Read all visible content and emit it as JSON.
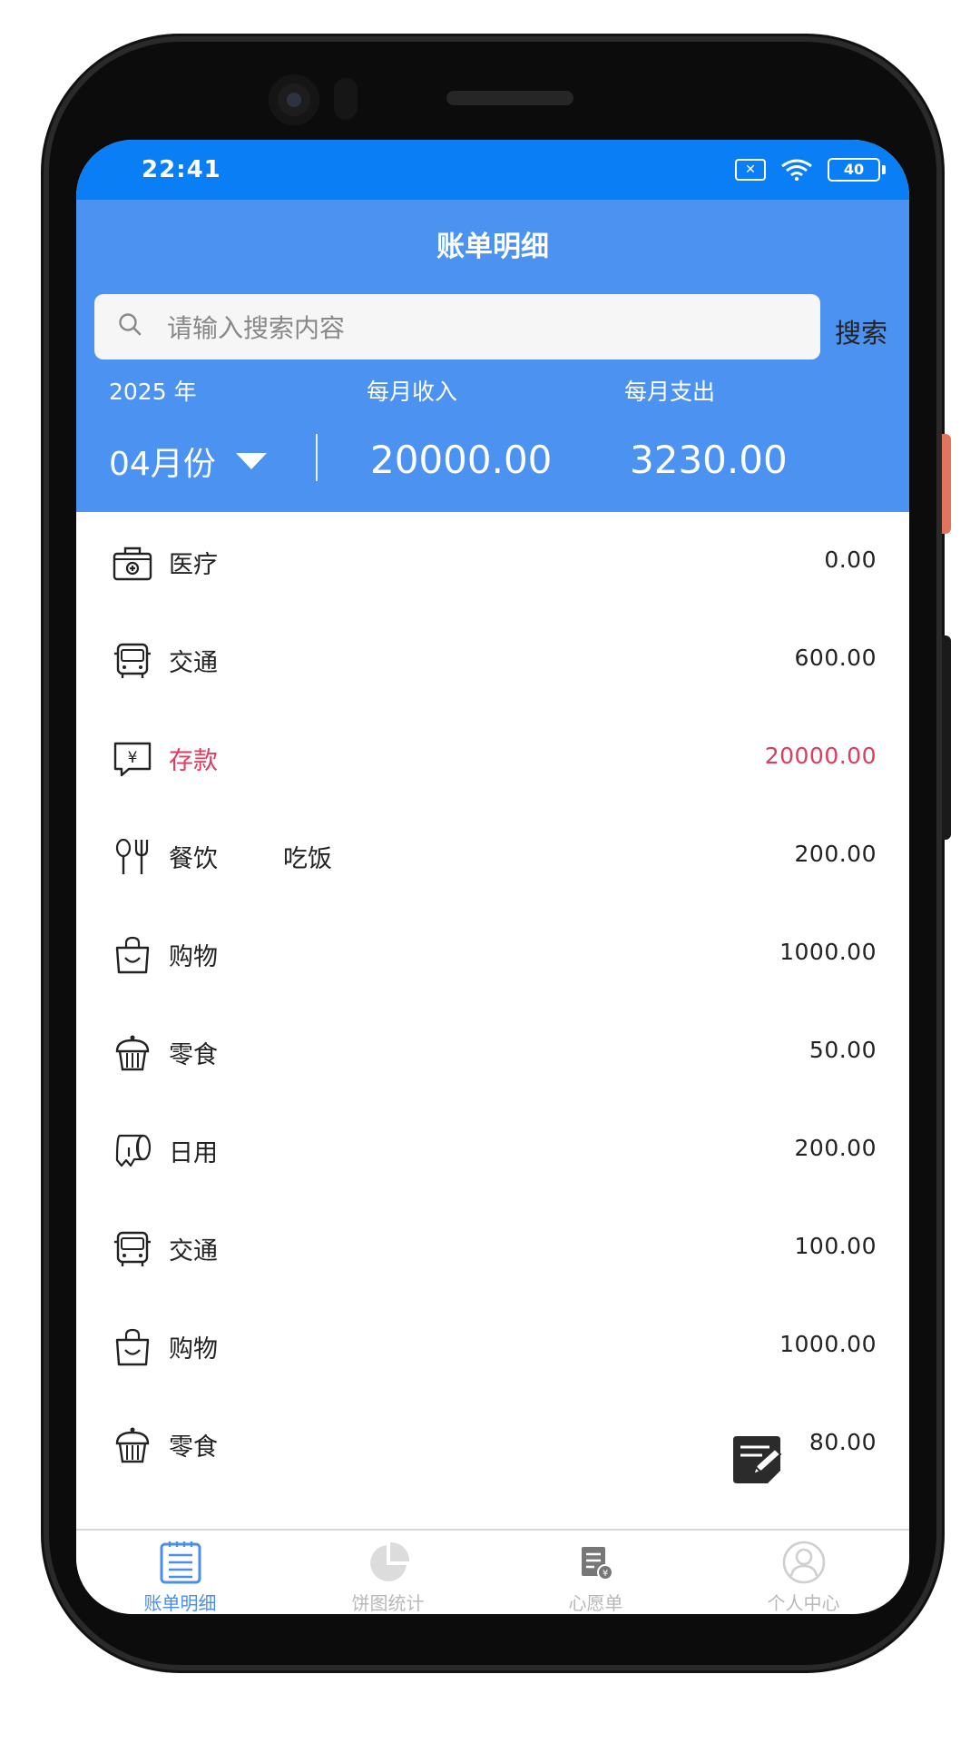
{
  "status_bar": {
    "time": "22:41",
    "battery": "40"
  },
  "header": {
    "title": "账单明细",
    "search": {
      "placeholder": "请输入搜索内容",
      "button": "搜索"
    },
    "year_label": "2025 年",
    "income_label": "每月收入",
    "expense_label": "每月支出",
    "month": "04月份",
    "income_amount": "20000.00",
    "expense_amount": "3230.00"
  },
  "records": [
    {
      "icon": "medical-kit-icon",
      "category": "医疗",
      "note": "",
      "amount": "0.00",
      "highlight": false
    },
    {
      "icon": "bus-icon",
      "category": "交通",
      "note": "",
      "amount": "600.00",
      "highlight": false
    },
    {
      "icon": "yuan-deposit-icon",
      "category": "存款",
      "note": "",
      "amount": "20000.00",
      "highlight": true
    },
    {
      "icon": "fork-spoon-icon",
      "category": "餐饮",
      "note": "吃饭",
      "amount": "200.00",
      "highlight": false
    },
    {
      "icon": "shopping-bag-icon",
      "category": "购物",
      "note": "",
      "amount": "1000.00",
      "highlight": false
    },
    {
      "icon": "cupcake-icon",
      "category": "零食",
      "note": "",
      "amount": "50.00",
      "highlight": false
    },
    {
      "icon": "tissue-roll-icon",
      "category": "日用",
      "note": "",
      "amount": "200.00",
      "highlight": false
    },
    {
      "icon": "bus-icon",
      "category": "交通",
      "note": "",
      "amount": "100.00",
      "highlight": false
    },
    {
      "icon": "shopping-bag-icon",
      "category": "购物",
      "note": "",
      "amount": "1000.00",
      "highlight": false
    },
    {
      "icon": "cupcake-icon",
      "category": "零食",
      "note": "",
      "amount": "80.00",
      "highlight": false
    }
  ],
  "colors": {
    "primary": "#4c92f0",
    "status_bar": "#0a7ff5",
    "highlight": "#e23a5e",
    "tab_active": "#4a8ee8",
    "tab_inactive": "#b8b8b8"
  },
  "tabs": [
    {
      "label": "账单明细",
      "icon": "bill-list-icon",
      "active": true
    },
    {
      "label": "饼图统计",
      "icon": "pie-chart-icon",
      "active": false
    },
    {
      "label": "心愿单",
      "icon": "wish-list-icon",
      "active": false
    },
    {
      "label": "个人中心",
      "icon": "user-profile-icon",
      "active": false
    }
  ]
}
